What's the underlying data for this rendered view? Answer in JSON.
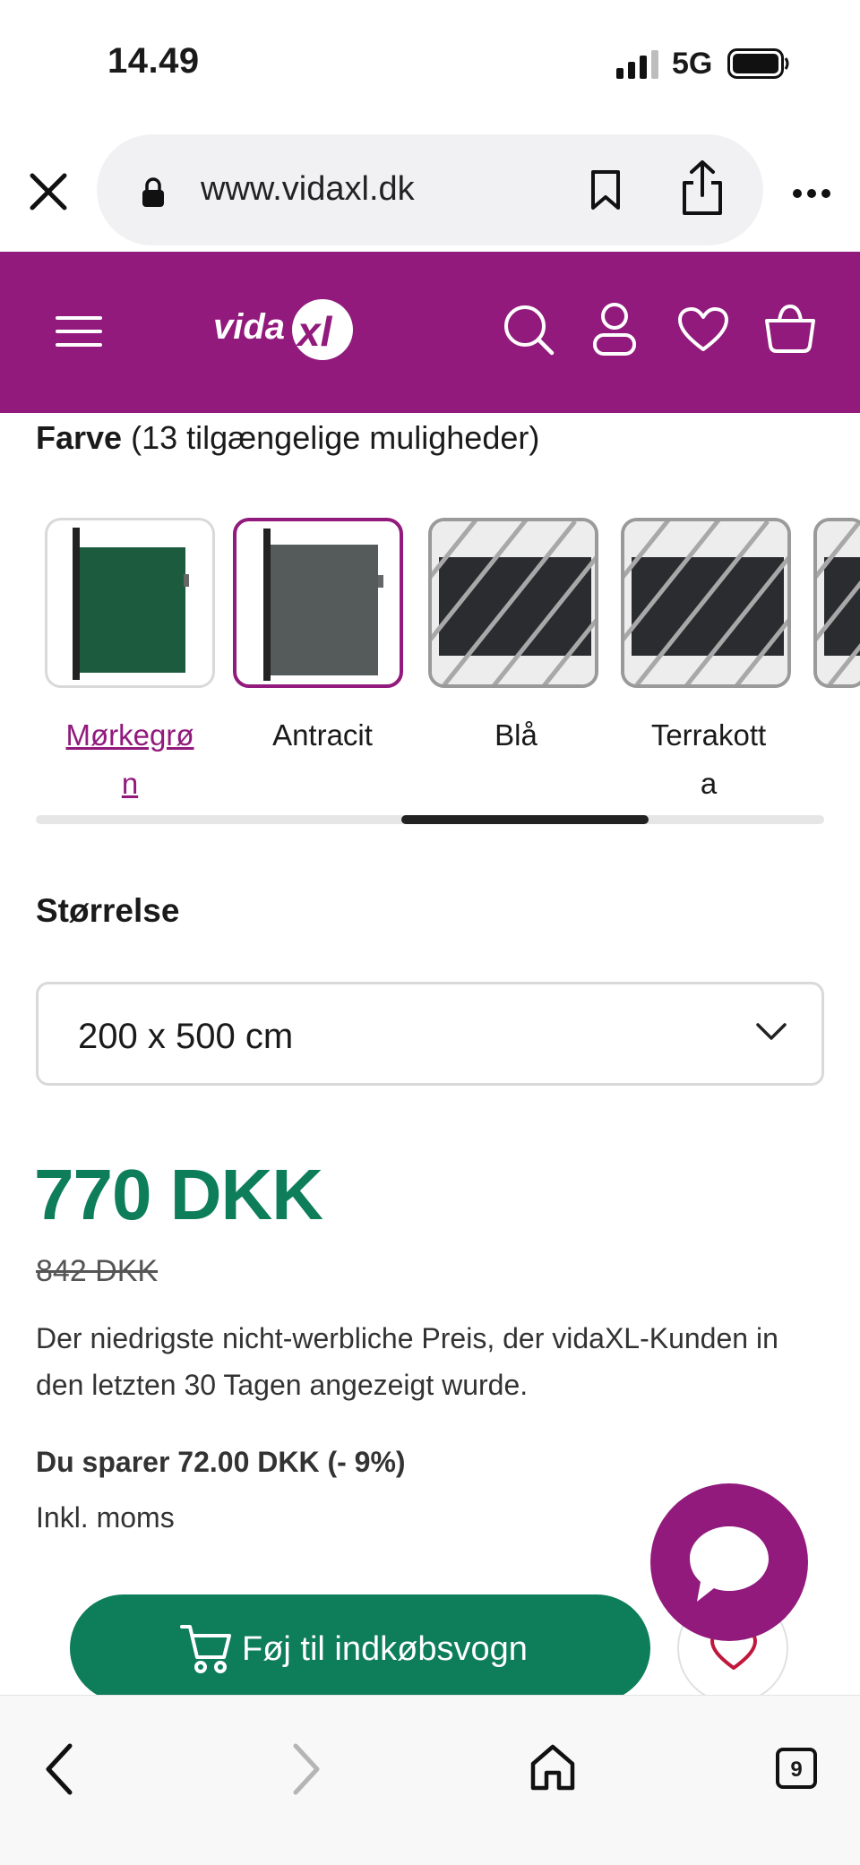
{
  "status_bar": {
    "time": "14.49",
    "network": "5G"
  },
  "browser": {
    "url": "www.vidaxl.dk",
    "tabs_count": "9"
  },
  "header": {
    "logo": "vidaXL",
    "icons": [
      "menu-icon",
      "search-icon",
      "account-icon",
      "wishlist-icon",
      "cart-icon"
    ],
    "brand_color": "#911a7c"
  },
  "color_section": {
    "title": "Farve",
    "subtitle": "(13 tilgængelige muligheder)",
    "options": [
      {
        "label_line1": "Mørkegrø",
        "label_line2": "n",
        "state": "active-link",
        "swatch_color": "#1d5b3f"
      },
      {
        "label_line1": "Antracit",
        "label_line2": "",
        "state": "selected",
        "swatch_color": "#555a5a"
      },
      {
        "label_line1": "Blå",
        "label_line2": "",
        "state": "unavailable",
        "swatch_color": "#2a2c2f"
      },
      {
        "label_line1": "Terrakott",
        "label_line2": "a",
        "state": "unavailable",
        "swatch_color": "#2a2c2f"
      }
    ]
  },
  "size_section": {
    "title": "Størrelse",
    "selected": "200 x 500 cm"
  },
  "pricing": {
    "price": "770 DKK",
    "old_price": "842 DKK",
    "note": "Der niedrigste nicht-werbliche Preis, der vidaXL-Kunden in den letzten 30 Tagen angezeigt wurde.",
    "savings": "Du sparer 72.00 DKK (- 9%)",
    "vat": "Inkl. moms",
    "price_color": "#0d7d5a"
  },
  "actions": {
    "add_to_cart": "Føj til indkøbsvogn"
  }
}
